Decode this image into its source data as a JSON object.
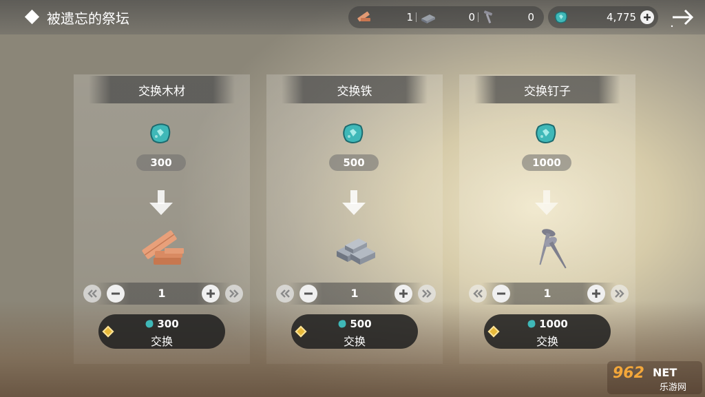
{
  "header": {
    "title": "被遗忘的祭坛"
  },
  "resources": {
    "wood_count": "1",
    "iron_count": "0",
    "nail_count": "0",
    "gem_count": "4,775"
  },
  "cards": [
    {
      "title": "交换木材",
      "cost": "300",
      "quantity": "1",
      "button_cost": "300",
      "button_label": "交换",
      "item": "wood-planks-icon"
    },
    {
      "title": "交换铁",
      "cost": "500",
      "quantity": "1",
      "button_cost": "500",
      "button_label": "交换",
      "item": "iron-ingot-icon"
    },
    {
      "title": "交换钉子",
      "cost": "1000",
      "quantity": "1",
      "button_cost": "1000",
      "button_label": "交换",
      "item": "nails-icon"
    }
  ],
  "watermark": {
    "main": "962NET",
    "sub": "乐游网"
  },
  "colors": {
    "gem": "#3fb8b8",
    "gold_diamond": "#e8b93a"
  }
}
